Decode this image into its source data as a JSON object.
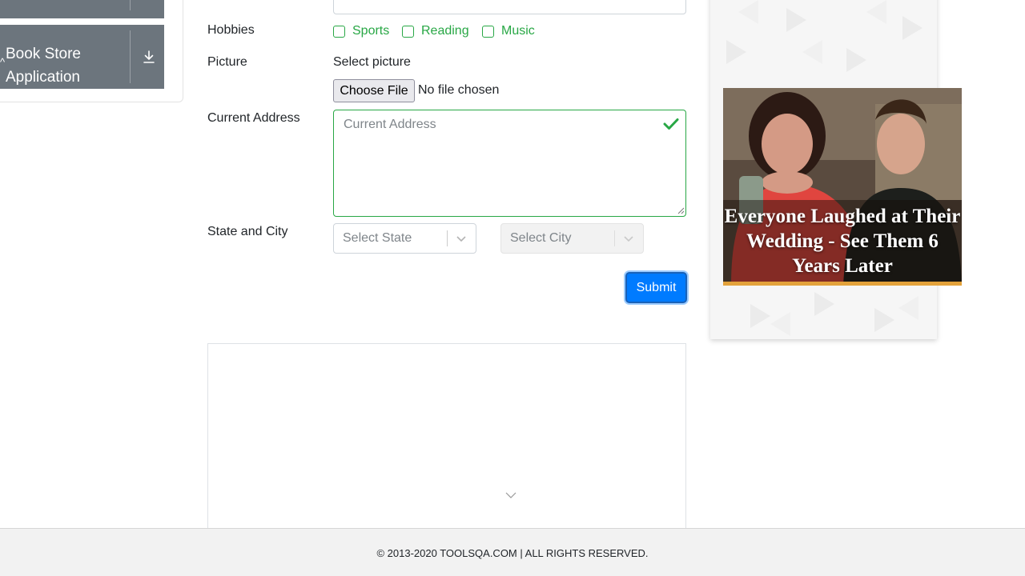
{
  "sidebar": {
    "groups": [
      {
        "label": "",
        "icon": "download-icon"
      },
      {
        "label": "Book Store Application",
        "icon": "download-icon"
      }
    ]
  },
  "form": {
    "hobbies_label": "Hobbies",
    "hobbies": [
      {
        "label": "Sports",
        "checked": false
      },
      {
        "label": "Reading",
        "checked": false
      },
      {
        "label": "Music",
        "checked": false
      }
    ],
    "picture_label": "Picture",
    "picture_prompt": "Select picture",
    "file_button": "Choose File",
    "file_status": "No file chosen",
    "address_label": "Current Address",
    "address_placeholder": "Current Address",
    "address_value": "",
    "state_city_label": "State and City",
    "state_placeholder": "Select State",
    "city_placeholder": "Select City",
    "submit_label": "Submit"
  },
  "ad": {
    "caption": "Everyone Laughed at Their Wedding - See Them 6 Years Later",
    "accent_color": "#e3a23b"
  },
  "footer": {
    "text": "© 2013-2020 TOOLSQA.COM | ALL RIGHTS RESERVED."
  },
  "colors": {
    "valid_green": "#28a745",
    "primary_blue": "#007bff",
    "sidebar_gray": "#6c757d"
  }
}
